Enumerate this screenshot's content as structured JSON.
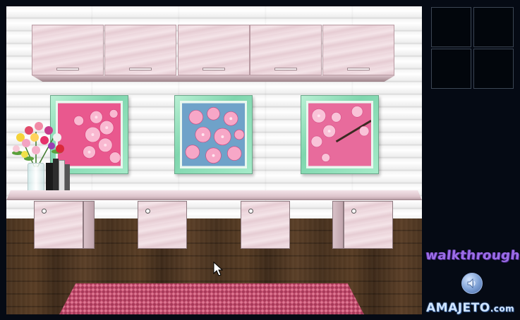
{
  "game": {
    "scene": "room-view-desk",
    "colors": {
      "background": "#050a14",
      "cabinet_pink": "#ecd6dc",
      "frame_mint": "#7fd6ae",
      "floor_wood": "#4a331f",
      "rug": "#c24e6e"
    }
  },
  "inventory": {
    "slots": [
      {
        "item": ""
      },
      {
        "item": ""
      },
      {
        "item": ""
      },
      {
        "item": ""
      }
    ]
  },
  "sidebar": {
    "walkthrough_label": "walkthrough",
    "sound_icon": "speaker-icon",
    "logo_text": "AMAJETO",
    "logo_suffix": ".com"
  }
}
